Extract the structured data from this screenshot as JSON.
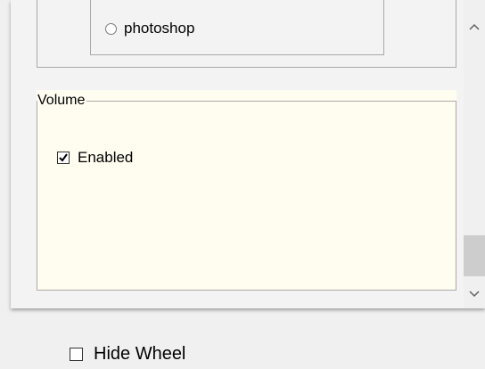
{
  "radio_option": {
    "label": "photoshop",
    "checked": false
  },
  "volume_group": {
    "title": "Volume",
    "enabled_label": "Enabled",
    "enabled_checked": true,
    "background": "#fffdf0"
  },
  "scrollbar": {
    "up_icon": "chevron-up-icon",
    "down_icon": "chevron-down-icon"
  },
  "hide_wheel": {
    "label": "Hide Wheel",
    "checked": false
  }
}
